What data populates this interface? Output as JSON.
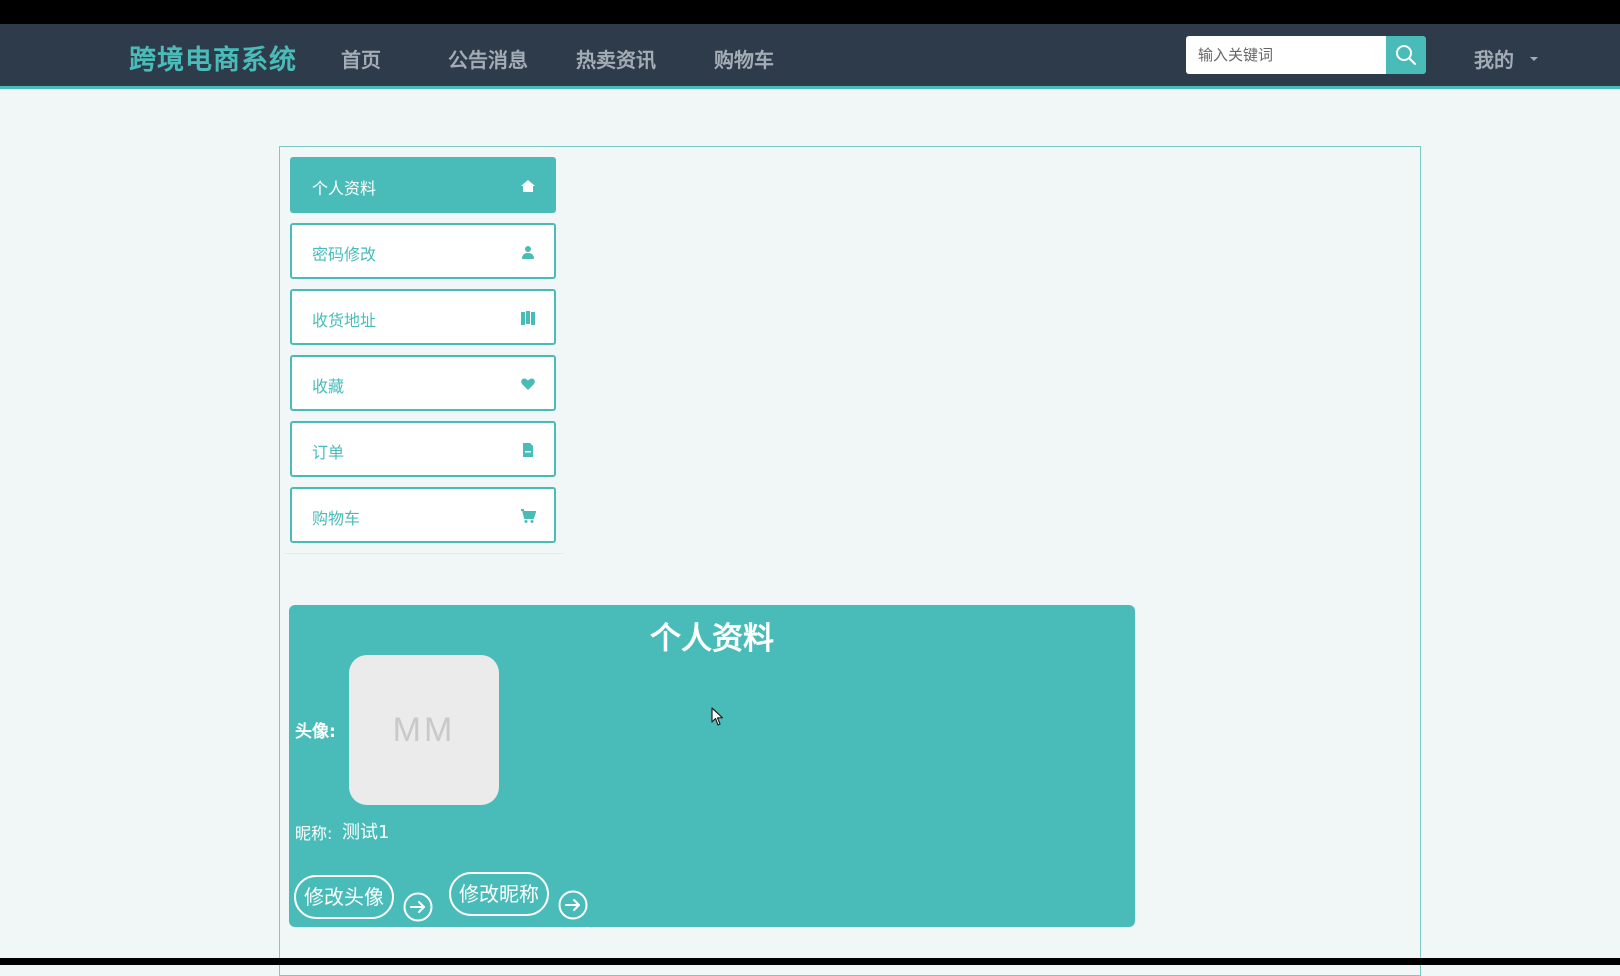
{
  "navbar": {
    "brand": "跨境电商系统",
    "links": [
      "首页",
      "公告消息",
      "热卖资讯",
      "购物车"
    ],
    "search_placeholder": "输入关键词",
    "mine_label": "我的"
  },
  "sidebar": {
    "items": [
      {
        "label": "个人资料",
        "icon": "home-icon",
        "active": true
      },
      {
        "label": "密码修改",
        "icon": "user-icon",
        "active": false
      },
      {
        "label": "收货地址",
        "icon": "map-icon",
        "active": false
      },
      {
        "label": "收藏",
        "icon": "heart-icon",
        "active": false
      },
      {
        "label": "订单",
        "icon": "file-icon",
        "active": false
      },
      {
        "label": "购物车",
        "icon": "cart-icon",
        "active": false
      }
    ]
  },
  "profile": {
    "title": "个人资料",
    "avatar_label": "头像:",
    "avatar_text": "MM",
    "nickname_label": "昵称:",
    "nickname_value": "测试1",
    "change_avatar_label": "修改头像",
    "change_nickname_label": "修改昵称"
  },
  "colors": {
    "accent": "#49bcba",
    "navbar_bg": "#2e3b4b",
    "page_bg": "#f1f6f7"
  }
}
